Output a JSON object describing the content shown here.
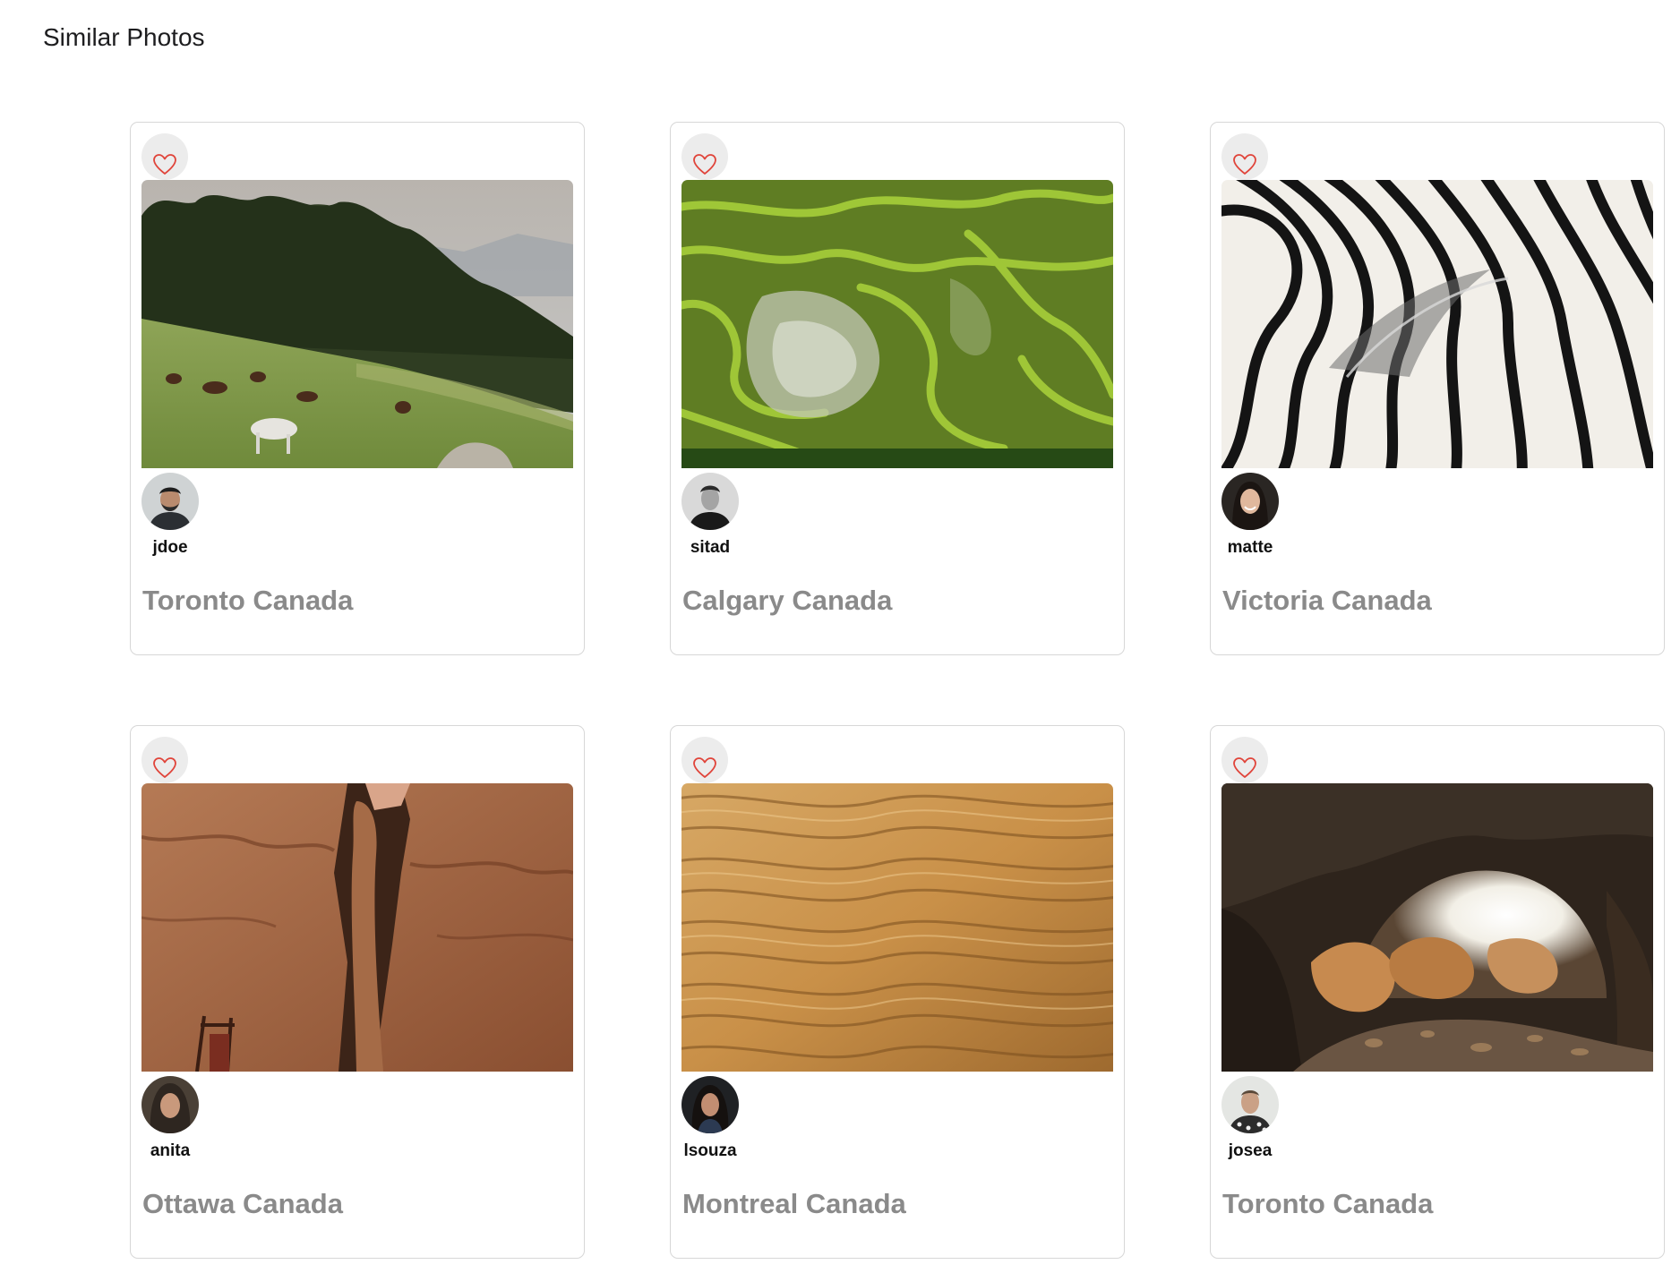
{
  "page": {
    "title": "Similar Photos"
  },
  "colors": {
    "heart_stroke": "#e0443a",
    "like_button_bg": "#ececec",
    "card_border": "#d7d7d7",
    "location_text": "#8a8a8a"
  },
  "cards": [
    {
      "username": "jdoe",
      "location": "Toronto Canada",
      "photo_subject": "horses grazing on a hillside below a forest",
      "avatar_icon": "man-portrait"
    },
    {
      "username": "sitad",
      "location": "Calgary Canada",
      "photo_subject": "green rice terraces from above",
      "avatar_icon": "man-portrait"
    },
    {
      "username": "matte",
      "location": "Victoria Canada",
      "photo_subject": "zebra stripes close-up",
      "avatar_icon": "woman-portrait"
    },
    {
      "username": "anita",
      "location": "Ottawa Canada",
      "photo_subject": "sandstone canyon walls",
      "avatar_icon": "woman-portrait"
    },
    {
      "username": "lsouza",
      "location": "Montreal Canada",
      "photo_subject": "rippled desert sand",
      "avatar_icon": "woman-portrait"
    },
    {
      "username": "josea",
      "location": "Toronto Canada",
      "photo_subject": "cave opening with boulders",
      "avatar_icon": "man-portrait"
    }
  ]
}
